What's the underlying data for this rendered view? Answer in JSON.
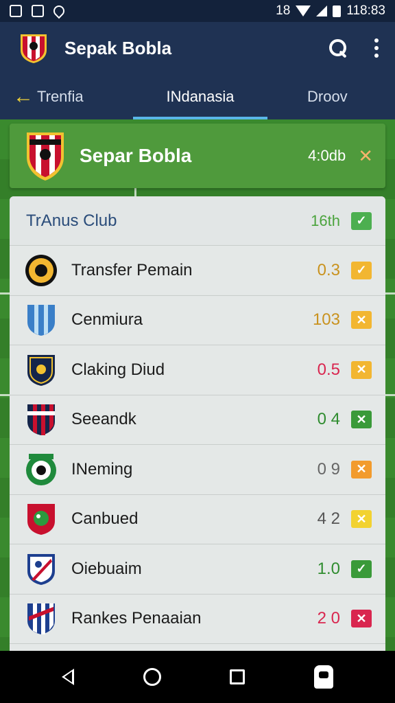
{
  "status_bar": {
    "time": "118:83",
    "network_label": "18",
    "icons": [
      "image-icon",
      "photo-icon",
      "location-icon",
      "wifi-icon",
      "signal-icon",
      "battery-icon"
    ]
  },
  "app_bar": {
    "title": "Sepak Bobla",
    "icons": [
      "club-logo-icon",
      "search-icon",
      "more-vert-icon"
    ]
  },
  "tabs": {
    "back_icon": "arrow-left-icon",
    "items": [
      {
        "label": "Trenfia"
      },
      {
        "label": "INdanasia",
        "selected": true
      },
      {
        "label": "Droov"
      }
    ]
  },
  "match_card": {
    "title": "Separ Bobla",
    "score": "4:0db",
    "close_icon": "close-icon"
  },
  "list": {
    "header": {
      "title": "TrAnus Club",
      "value": "16th",
      "status": "check"
    },
    "rows": [
      {
        "name": "Transfer Pemain",
        "value": "0.3",
        "value_color": "#c9921e",
        "status": "check",
        "status_color": "#f2b631",
        "crest": "crest-gold-icon"
      },
      {
        "name": "Cenmiura",
        "value": "103",
        "value_color": "#c9921e",
        "status": "cross",
        "status_color": "#f2b631",
        "crest": "crest-sky-icon"
      },
      {
        "name": "Claking Diud",
        "value": "0.5",
        "value_color": "#d9264f",
        "status": "cross",
        "status_color": "#f2b631",
        "crest": "crest-navy-icon"
      },
      {
        "name": "Seeandk",
        "value": "0 4",
        "value_color": "#2f8c2f",
        "status": "cross",
        "status_color": "#3a9a39",
        "crest": "crest-red-icon"
      },
      {
        "name": "INeming",
        "value": "0 9",
        "value_color": "#666666",
        "status": "cross",
        "status_color": "#f29b2d",
        "crest": "crest-green-icon"
      },
      {
        "name": "Canbued",
        "value": "4 2",
        "value_color": "#555555",
        "status": "cross",
        "status_color": "#f2d230",
        "crest": "crest-dragon-icon"
      },
      {
        "name": "Oiebuaim",
        "value": "1.0",
        "value_color": "#2f8c2f",
        "status": "check",
        "status_color": "#3a9a39",
        "crest": "crest-blue-icon"
      },
      {
        "name": "Rankes Penaaian",
        "value": "2 0",
        "value_color": "#d9264f",
        "status": "cross",
        "status_color": "#d9264f",
        "crest": "crest-striped-icon"
      }
    ]
  },
  "nav_bar": {
    "icons": [
      "nav-back-icon",
      "nav-home-icon",
      "nav-recents-icon",
      "assistant-icon"
    ]
  }
}
